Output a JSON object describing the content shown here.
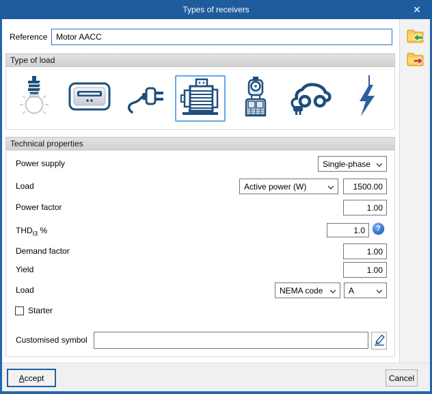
{
  "window": {
    "title": "Types of receivers",
    "close_glyph": "✕"
  },
  "reference": {
    "label": "Reference",
    "value": "Motor AACC"
  },
  "icons": {
    "import": "folder-arrow-in-icon",
    "export": "folder-arrow-out-icon",
    "edit": "pencil-icon",
    "help": "question-mark-icon",
    "help_glyph": "?",
    "close": "x-icon"
  },
  "type_of_load": {
    "title": "Type of load",
    "options": [
      {
        "name": "lighting",
        "selected": false
      },
      {
        "name": "heater",
        "selected": false
      },
      {
        "name": "socket-outlet",
        "selected": false
      },
      {
        "name": "motor",
        "selected": true
      },
      {
        "name": "lift",
        "selected": false
      },
      {
        "name": "ev-charger",
        "selected": false
      },
      {
        "name": "generic-load",
        "selected": false
      }
    ]
  },
  "technical": {
    "title": "Technical properties",
    "power_supply": {
      "label": "Power supply",
      "value": "Single-phase"
    },
    "load": {
      "label": "Load",
      "type_value": "Active power (W)",
      "amount": "1500.00"
    },
    "power_factor": {
      "label": "Power factor",
      "value": "1.00"
    },
    "thd": {
      "label": "THD",
      "label_sub": "I3",
      "label_suffix": " %",
      "value": "1.0"
    },
    "demand_factor": {
      "label": "Demand factor",
      "value": "1.00"
    },
    "yield": {
      "label": "Yield",
      "value": "1.00"
    },
    "load_code": {
      "label": "Load",
      "code_type": "NEMA code",
      "code_value": "A"
    },
    "starter": {
      "label": "Starter",
      "checked": false
    },
    "customised_symbol": {
      "label": "Customised symbol",
      "value": "",
      "placeholder": ""
    }
  },
  "footer": {
    "accept_underlined": "A",
    "accept_rest": "ccept",
    "cancel": "Cancel"
  },
  "colors": {
    "titlebar": "#1e5c9e",
    "frame": "#2465ae",
    "focus_border": "#2a6fc8",
    "selected_border": "#63a9e8",
    "icon_blue": "#1d4e7d",
    "bolt_blue": "#2e5f9d",
    "folder_yellow": "#f9c94c",
    "arrow_green": "#2f9e44",
    "arrow_red": "#d23b2f"
  }
}
